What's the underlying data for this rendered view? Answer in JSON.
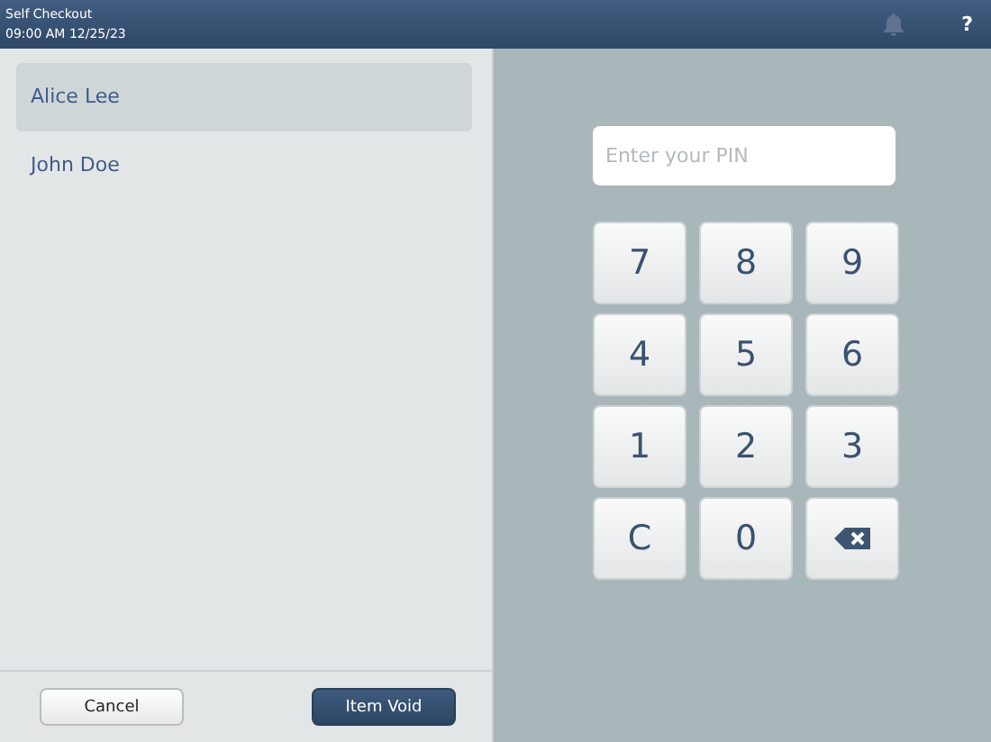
{
  "header": {
    "title": "Self Checkout",
    "datetime": "09:00 AM 12/25/23",
    "help": "?"
  },
  "users": [
    {
      "name": "Alice Lee",
      "selected": true
    },
    {
      "name": "John Doe",
      "selected": false
    }
  ],
  "pin": {
    "placeholder": "Enter your PIN"
  },
  "keys": [
    {
      "kind": "digit",
      "label": "7"
    },
    {
      "kind": "digit",
      "label": "8"
    },
    {
      "kind": "digit",
      "label": "9"
    },
    {
      "kind": "digit",
      "label": "4"
    },
    {
      "kind": "digit",
      "label": "5"
    },
    {
      "kind": "digit",
      "label": "6"
    },
    {
      "kind": "digit",
      "label": "1"
    },
    {
      "kind": "digit",
      "label": "2"
    },
    {
      "kind": "digit",
      "label": "3"
    },
    {
      "kind": "digit",
      "label": "C"
    },
    {
      "kind": "digit",
      "label": "0"
    },
    {
      "kind": "backspace"
    }
  ],
  "buttons": [
    {
      "label": "Cancel",
      "kind": "secondary"
    },
    {
      "label": "Item Void",
      "kind": "primary"
    }
  ]
}
